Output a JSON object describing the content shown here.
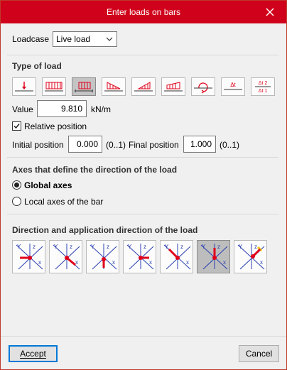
{
  "window": {
    "title": "Enter loads on bars"
  },
  "loadcase": {
    "label": "Loadcase",
    "value": "Live load"
  },
  "type_of_load": {
    "title": "Type of load",
    "tools": [
      {
        "name": "point-load-icon"
      },
      {
        "name": "uniform-load-icon"
      },
      {
        "name": "partial-uniform-load-icon"
      },
      {
        "name": "triangular-load-icon"
      },
      {
        "name": "partial-triangular-load-icon"
      },
      {
        "name": "trapezoidal-load-icon"
      },
      {
        "name": "moment-load-icon"
      },
      {
        "name": "thermal-load-icon",
        "text": "Δt"
      },
      {
        "name": "thermal-gradient-icon",
        "text_top": "Δt 2",
        "text_bottom": "Δt 1"
      }
    ],
    "selected_index": 2
  },
  "value": {
    "label": "Value",
    "value": "9.810",
    "unit": "kN/m"
  },
  "relative_position": {
    "label": "Relative position",
    "checked": true
  },
  "initial_position": {
    "label": "Initial position",
    "value": "0.000",
    "range": "(0..1)"
  },
  "final_position": {
    "label": "Final position",
    "value": "1.000",
    "range": "(0..1)"
  },
  "axes": {
    "title": "Axes that define the direction of the load",
    "options": [
      "Global axes",
      "Local axes of the bar"
    ],
    "selected_index": 0
  },
  "direction": {
    "title": "Direction and application direction of the load",
    "buttons": [
      {
        "name": "direction-x-icon"
      },
      {
        "name": "direction-minus-y-icon"
      },
      {
        "name": "direction-plus-z-icon"
      },
      {
        "name": "direction-minus-x-icon"
      },
      {
        "name": "direction-y-icon"
      },
      {
        "name": "direction-minus-z-icon"
      },
      {
        "name": "direction-arbitrary-icon"
      }
    ],
    "selected_index": 5,
    "axis_labels": {
      "x": "x",
      "y": "Y",
      "z": "z"
    }
  },
  "footer": {
    "accept_label": "Accept",
    "cancel_label": "Cancel"
  },
  "colors": {
    "titlebar": "#d0021b",
    "arrow": "#e0001a",
    "accent": "#0078d7",
    "axis": "#2b3fb0"
  }
}
